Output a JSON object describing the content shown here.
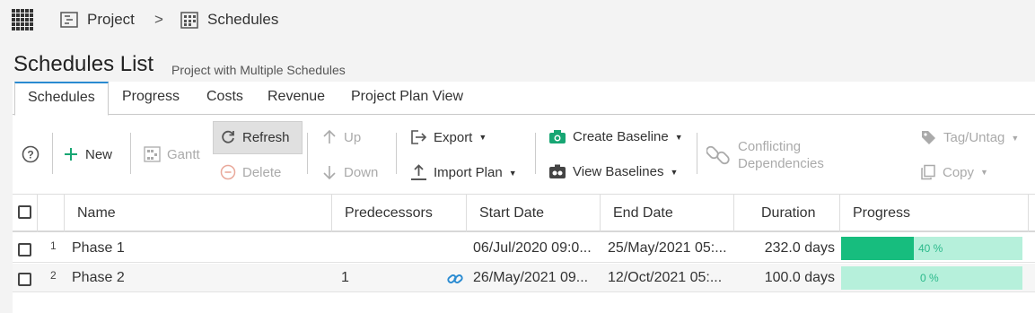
{
  "breadcrumb": {
    "project": "Project",
    "separator": ">",
    "schedules": "Schedules"
  },
  "page": {
    "title": "Schedules List",
    "subtitle": "Project with Multiple Schedules"
  },
  "tabs": [
    "Schedules",
    "Progress",
    "Costs",
    "Revenue",
    "Project Plan View"
  ],
  "toolbar": {
    "help": "?",
    "new": "New",
    "gantt": "Gantt",
    "refresh": "Refresh",
    "delete": "Delete",
    "up": "Up",
    "down": "Down",
    "export": "Export",
    "import_plan": "Import Plan",
    "create_baseline": "Create Baseline",
    "view_baselines": "View Baselines",
    "conflicting_1": "Conflicting",
    "conflicting_2": "Dependencies",
    "tag_untag": "Tag/Untag",
    "copy": "Copy"
  },
  "columns": [
    "Name",
    "Predecessors",
    "Start Date",
    "End Date",
    "Duration",
    "Progress"
  ],
  "rows": [
    {
      "index": "1",
      "name": "Phase 1",
      "predecessors": "",
      "start": "06/Jul/2020 09:0...",
      "end": "25/May/2021 05:...",
      "duration": "232.0 days",
      "progress": 0.4,
      "progress_label": "40 %"
    },
    {
      "index": "2",
      "name": "Phase 2",
      "predecessors": "1",
      "start": "26/May/2021 09...",
      "end": "12/Oct/2021 05:...",
      "duration": "100.0 days",
      "progress": 0.0,
      "progress_label": "0 %"
    }
  ],
  "colors": {
    "accent": "#2a8bd1",
    "progress_fill": "#17bd7e",
    "progress_track": "#b6f0db",
    "new_icon": "#17a673",
    "baseline_icon": "#17a673"
  },
  "icons": [
    "apps-grid-icon",
    "project-icon",
    "schedule-icon",
    "help-icon",
    "plus-icon",
    "gantt-icon",
    "refresh-icon",
    "delete-icon",
    "arrow-up-icon",
    "arrow-down-icon",
    "export-icon",
    "import-icon",
    "camera-icon",
    "baselines-icon",
    "link-icon",
    "tag-icon",
    "copy-icon"
  ]
}
